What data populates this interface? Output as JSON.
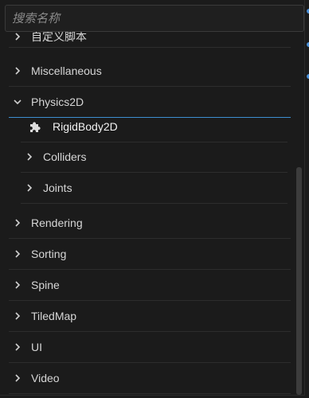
{
  "search": {
    "placeholder": "搜索名称"
  },
  "tree": {
    "cut_item": "自定义脚本",
    "miscellaneous": "Miscellaneous",
    "physics2d": "Physics2D",
    "rigidbody2d": "RigidBody2D",
    "colliders": "Colliders",
    "joints": "Joints",
    "rendering": "Rendering",
    "sorting": "Sorting",
    "spine": "Spine",
    "tiledmap": "TiledMap",
    "ui": "UI",
    "video": "Video"
  },
  "icons": {
    "collapsed": "chevron-right-icon",
    "expanded": "chevron-down-icon",
    "component": "puzzle-icon"
  },
  "colors": {
    "background": "#1b1b1b",
    "accent": "#3d8fd1",
    "text": "#d6d6d6",
    "divider": "#2d2d2d"
  }
}
